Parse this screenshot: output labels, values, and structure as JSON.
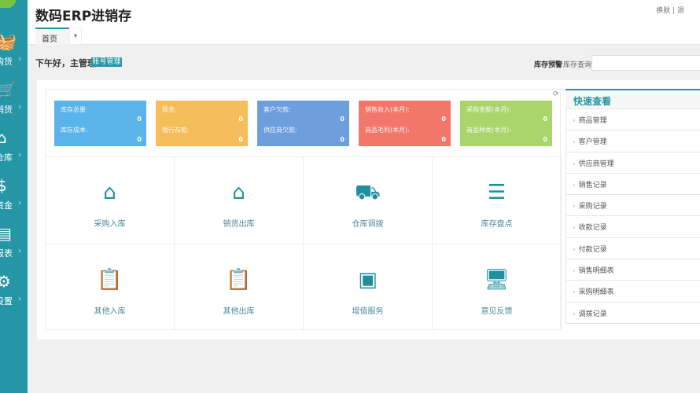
{
  "app": {
    "title": "数码ERP进销存"
  },
  "sidebar": {
    "items": [
      {
        "label": "购货",
        "icon": "basket-icon",
        "glyph": "🧺"
      },
      {
        "label": "销货",
        "icon": "cart-icon",
        "glyph": "🛒"
      },
      {
        "label": "仓库",
        "icon": "warehouse-icon",
        "glyph": "⌂"
      },
      {
        "label": "资金",
        "icon": "dollar-icon",
        "glyph": "$"
      },
      {
        "label": "报表",
        "icon": "report-icon",
        "glyph": "▤"
      },
      {
        "label": "设置",
        "icon": "gear-icon",
        "glyph": "⚙"
      }
    ]
  },
  "tabs": [
    {
      "label": "首页"
    }
  ],
  "tab_dropdown": "▾",
  "top_links": "换肤 | 退",
  "greeting": "下午好，主管理",
  "account_button": "账号管理",
  "stock_warning": "库存预警",
  "stock_query": "库存查询",
  "cards": [
    {
      "label1": "库存总量:",
      "value1": "0",
      "label2": "库存成本:",
      "value2": "0",
      "color": "#5ab4ea"
    },
    {
      "label1": "现金:",
      "value1": "0",
      "label2": "银行存款:",
      "value2": "0",
      "color": "#f6be5a"
    },
    {
      "label1": "客户欠款:",
      "value1": "0",
      "label2": "供应商欠款:",
      "value2": "0",
      "color": "#6c9fdc"
    },
    {
      "label1": "销售收入(本月):",
      "value1": "0",
      "label2": "商品毛利(本月):",
      "value2": "0",
      "color": "#f3766a"
    },
    {
      "label1": "采购金额(本月):",
      "value1": "0",
      "label2": "商品种类(本月):",
      "value2": "0",
      "color": "#a9d56b"
    }
  ],
  "shortcuts": [
    {
      "label": "采购入库",
      "glyph": "⌂"
    },
    {
      "label": "销货出库",
      "glyph": "⌂"
    },
    {
      "label": "仓库调拨",
      "glyph": "⛟"
    },
    {
      "label": "库存盘点",
      "glyph": "☰"
    },
    {
      "label": "其他入库",
      "glyph": "📋"
    },
    {
      "label": "其他出库",
      "glyph": "📋"
    },
    {
      "label": "增值服务",
      "glyph": "▣"
    },
    {
      "label": "意见反馈",
      "glyph": "🖥"
    }
  ],
  "quick_view": {
    "title": "快速查看",
    "items": [
      "商品管理",
      "客户管理",
      "供应商管理",
      "销售记录",
      "采购记录",
      "收款记录",
      "付款记录",
      "销售明细表",
      "采购明细表",
      "调拨记录"
    ]
  }
}
